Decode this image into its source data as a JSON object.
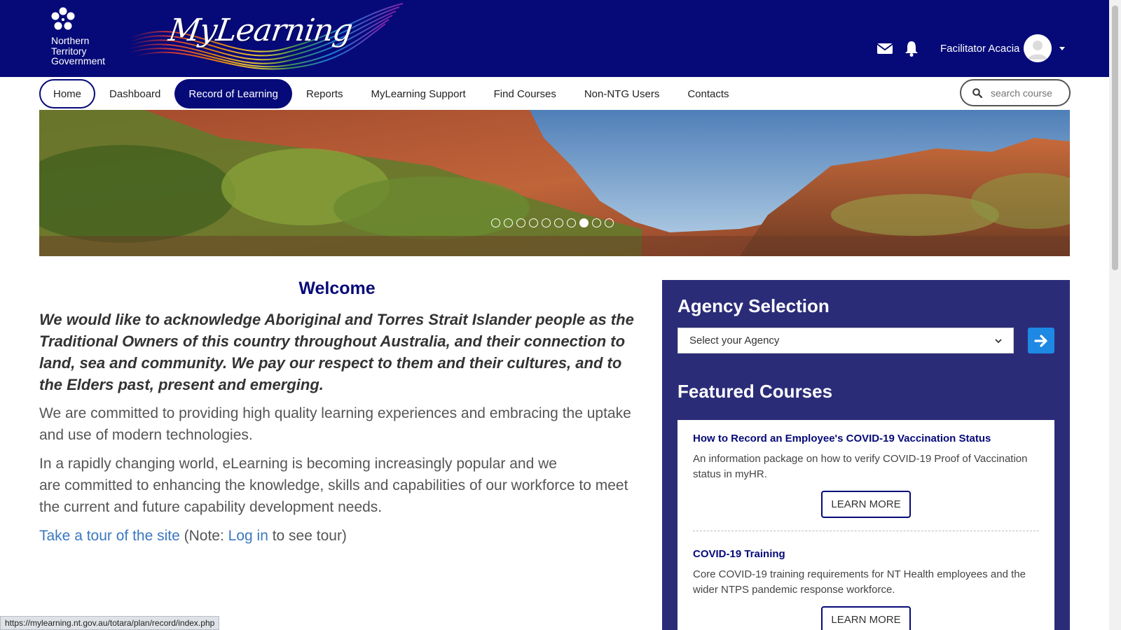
{
  "header": {
    "ntg_logo_lines": [
      "Northern",
      "Territory",
      "Government"
    ],
    "brand": "MyLearning",
    "user_name": "Facilitator Acacia",
    "icons": [
      "mail-icon",
      "bell-icon",
      "caret-down-icon"
    ]
  },
  "nav": {
    "items": [
      "Home",
      "Dashboard",
      "Record of Learning",
      "Reports",
      "MyLearning Support",
      "Find Courses",
      "Non-NTG Users",
      "Contacts"
    ],
    "active_item": "Record of Learning",
    "search_placeholder": "search course"
  },
  "banner": {
    "slide_count": 10,
    "active_slide": 8
  },
  "welcome": {
    "title": "Welcome",
    "acknowledgement": "We would like to acknowledge Aboriginal and Torres Strait Islander people as the Traditional Owners of this country throughout Australia, and their connection to land, sea and community. We pay our respect to them and their cultures, and to the Elders past, present and emerging.",
    "paragraph1": "We are committed to providing high quality learning experiences and embracing the uptake and use of modern technologies.",
    "paragraph2_line1": "In a rapidly changing world, eLearning is becoming increasingly popular and we",
    "paragraph2_line2": "are committed to enhancing the knowledge, skills and capabilities of our workforce to meet the current and future capability development needs.",
    "tour_link": "Take a tour of the site",
    "note_prefix": " (Note: ",
    "login_link": "Log in",
    "note_suffix": " to see tour)"
  },
  "agency": {
    "title": "Agency Selection",
    "select_value": "Select your Agency"
  },
  "featured": {
    "title": "Featured Courses",
    "courses": [
      {
        "title": "How to Record an Employee's COVID-19 Vaccination Status",
        "description": "An information package on how to verify COVID-19 Proof of Vaccination status in myHR.",
        "button": "LEARN MORE"
      },
      {
        "title": "COVID-19 Training",
        "description": "Core COVID-19 training requirements for NT Health employees and the wider NTPS pandemic response workforce.",
        "button": "LEARN MORE"
      }
    ]
  },
  "statusbar": {
    "url": "https://mylearning.nt.gov.au/totara/plan/record/index.php"
  },
  "colors": {
    "header_bg": "#060a78",
    "panel_bg": "#2b2c78",
    "go_button": "#1e88e5",
    "link": "#3a78bf"
  }
}
